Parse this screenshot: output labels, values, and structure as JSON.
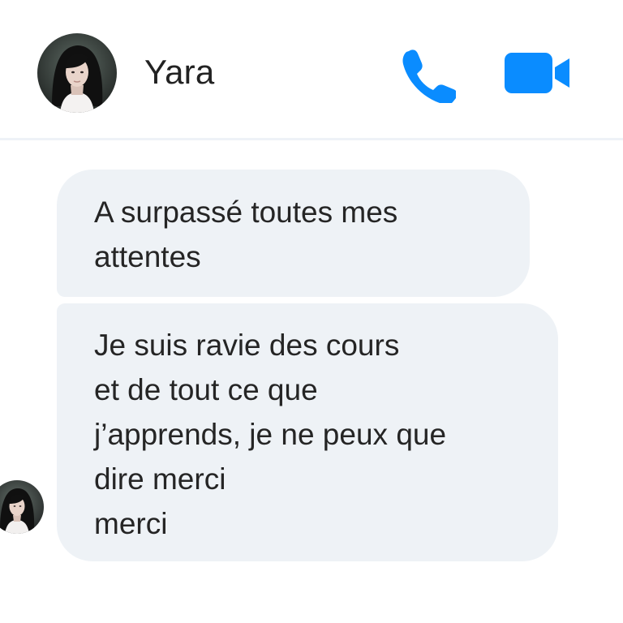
{
  "header": {
    "contact_name": "Yara",
    "avatar_icon": "contact-avatar",
    "call_icon": "phone-icon",
    "video_icon": "video-camera-icon",
    "accent_color": "#0A8CFF"
  },
  "messages": [
    {
      "text": "A surpassé toutes mes\nattentes"
    },
    {
      "text": "Je suis ravie des cours\net de tout ce que\nj’apprends, je ne peux que\ndire merci\nmerci"
    }
  ],
  "theme": {
    "bubble_background": "#EEF2F6",
    "divider": "#EEF2F7"
  }
}
